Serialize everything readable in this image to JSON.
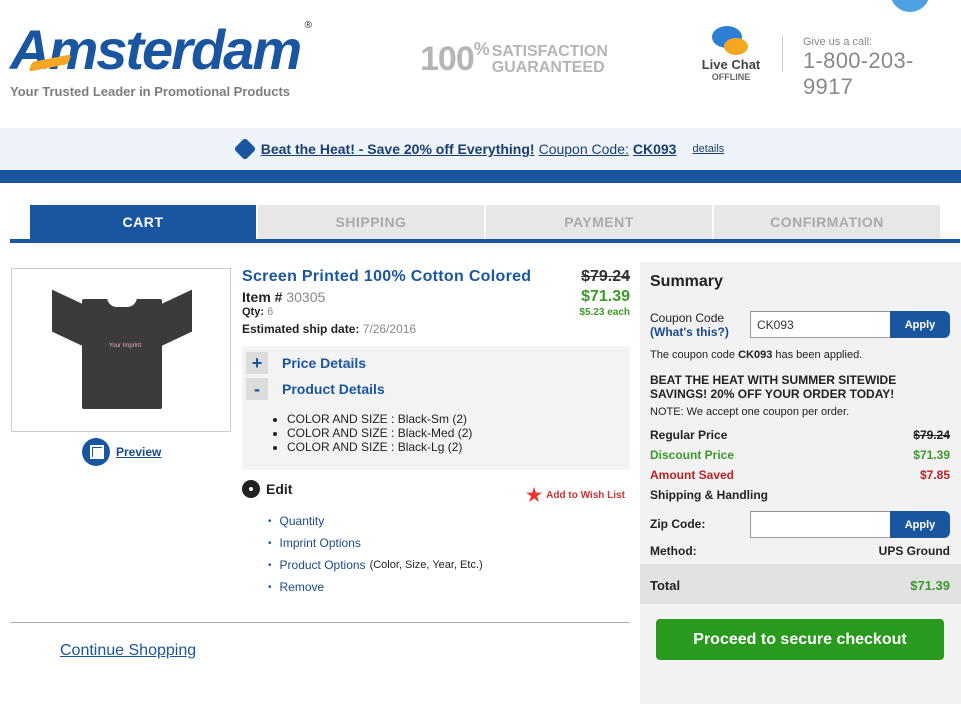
{
  "header": {
    "logo": "Amsterdam",
    "tagline": "Your Trusted Leader in Promotional Products",
    "satisfaction_number": "100",
    "satisfaction_pct": "%",
    "satisfaction_line1": "SATISFACTION",
    "satisfaction_line2": "GUARANTEED",
    "chat_title": "Live Chat",
    "chat_status": "OFFLINE",
    "call_label": "Give us a call:",
    "call_number": "1-800-203-9917"
  },
  "promo": {
    "headline": "Beat the Heat! - Save 20% off Everything!",
    "code_label": "Coupon Code:",
    "code": "CK093",
    "details": "details"
  },
  "steps": [
    "CART",
    "SHIPPING",
    "PAYMENT",
    "CONFIRMATION"
  ],
  "product": {
    "shirt_print_text": "Your Imprint",
    "title": "Screen Printed 100% Cotton Colored",
    "item_label": "Item #",
    "item_number": "30305",
    "qty_label": "Qty:",
    "qty": "6",
    "ship_label": "Estimated ship date:",
    "ship_date": "7/26/2016",
    "price_old": "$79.24",
    "price_new": "$71.39",
    "price_each": "$5.23 each",
    "preview": "Preview",
    "price_details": "Price Details",
    "product_details": "Product Details",
    "options": [
      "COLOR AND SIZE : Black-Sm (2)",
      "COLOR AND SIZE : Black-Med (2)",
      "COLOR AND SIZE : Black-Lg (2)"
    ],
    "edit": "Edit",
    "wishlist": "Add to Wish List",
    "edit_links": {
      "quantity": "Quantity",
      "imprint": "Imprint Options",
      "product_options": "Product Options",
      "product_options_note": "(Color, Size, Year, Etc.)",
      "remove": "Remove"
    },
    "continue": "Continue Shopping"
  },
  "summary": {
    "title": "Summary",
    "coupon_label": "Coupon Code",
    "whats_this": "(What's this?)",
    "coupon_value": "CK093",
    "apply": "Apply",
    "applied_prefix": "The coupon code",
    "applied_code": "CK093",
    "applied_suffix": "has been applied.",
    "promo_caps": "BEAT THE HEAT WITH SUMMER SITEWIDE SAVINGS! 20% OFF YOUR ORDER TODAY!",
    "note": "NOTE: We accept one coupon per order.",
    "regular_label": "Regular Price",
    "regular_value": "$79.24",
    "discount_label": "Discount Price",
    "discount_value": "$71.39",
    "saved_label": "Amount Saved",
    "saved_value": "$7.85",
    "shipping_label": "Shipping & Handling",
    "zip_label": "Zip Code:",
    "zip_value": "",
    "method_label": "Method:",
    "method_value": "UPS Ground",
    "total_label": "Total",
    "total_value": "$71.39",
    "checkout": "Proceed to secure checkout"
  },
  "colors": {
    "brand_blue": "#1a56a0",
    "accent_orange": "#f5a623",
    "green": "#3a9a2a",
    "red": "#b22222"
  }
}
